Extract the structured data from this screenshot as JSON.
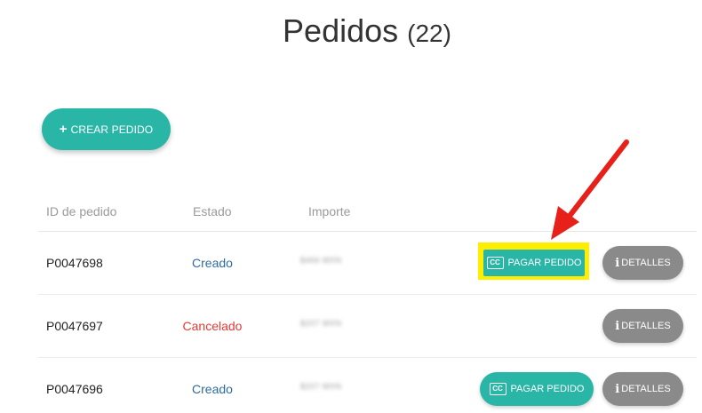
{
  "header": {
    "title": "Pedidos",
    "count": "(22)"
  },
  "actions": {
    "create_label": "CREAR PEDIDO"
  },
  "table": {
    "columns": [
      "ID de pedido",
      "Estado",
      "Importe"
    ],
    "rows": [
      {
        "id": "P0047698",
        "status": "Creado",
        "amount": "$466 MXN",
        "pay_label": "PAGAR PEDIDO",
        "details_label": "DETALLES"
      },
      {
        "id": "P0047697",
        "status": "Cancelado",
        "amount": "$207 MXN",
        "details_label": "DETALLES"
      },
      {
        "id": "P0047696",
        "status": "Creado",
        "amount": "$207 MXN",
        "pay_label": "PAGAR PEDIDO",
        "details_label": "DETALLES"
      }
    ]
  },
  "icons": {
    "create": "plus-icon",
    "pay": "credit-card-icon",
    "details": "info-icon",
    "card_glyph": "CC",
    "info_glyph": "i",
    "plus_glyph": "+"
  },
  "colors": {
    "accent": "#29b6a6",
    "details": "#8a8a8a",
    "status_created": "#2e6ca0",
    "status_cancelled": "#e53935",
    "highlight": "#ffee00",
    "annotation_arrow": "#e8201a"
  }
}
